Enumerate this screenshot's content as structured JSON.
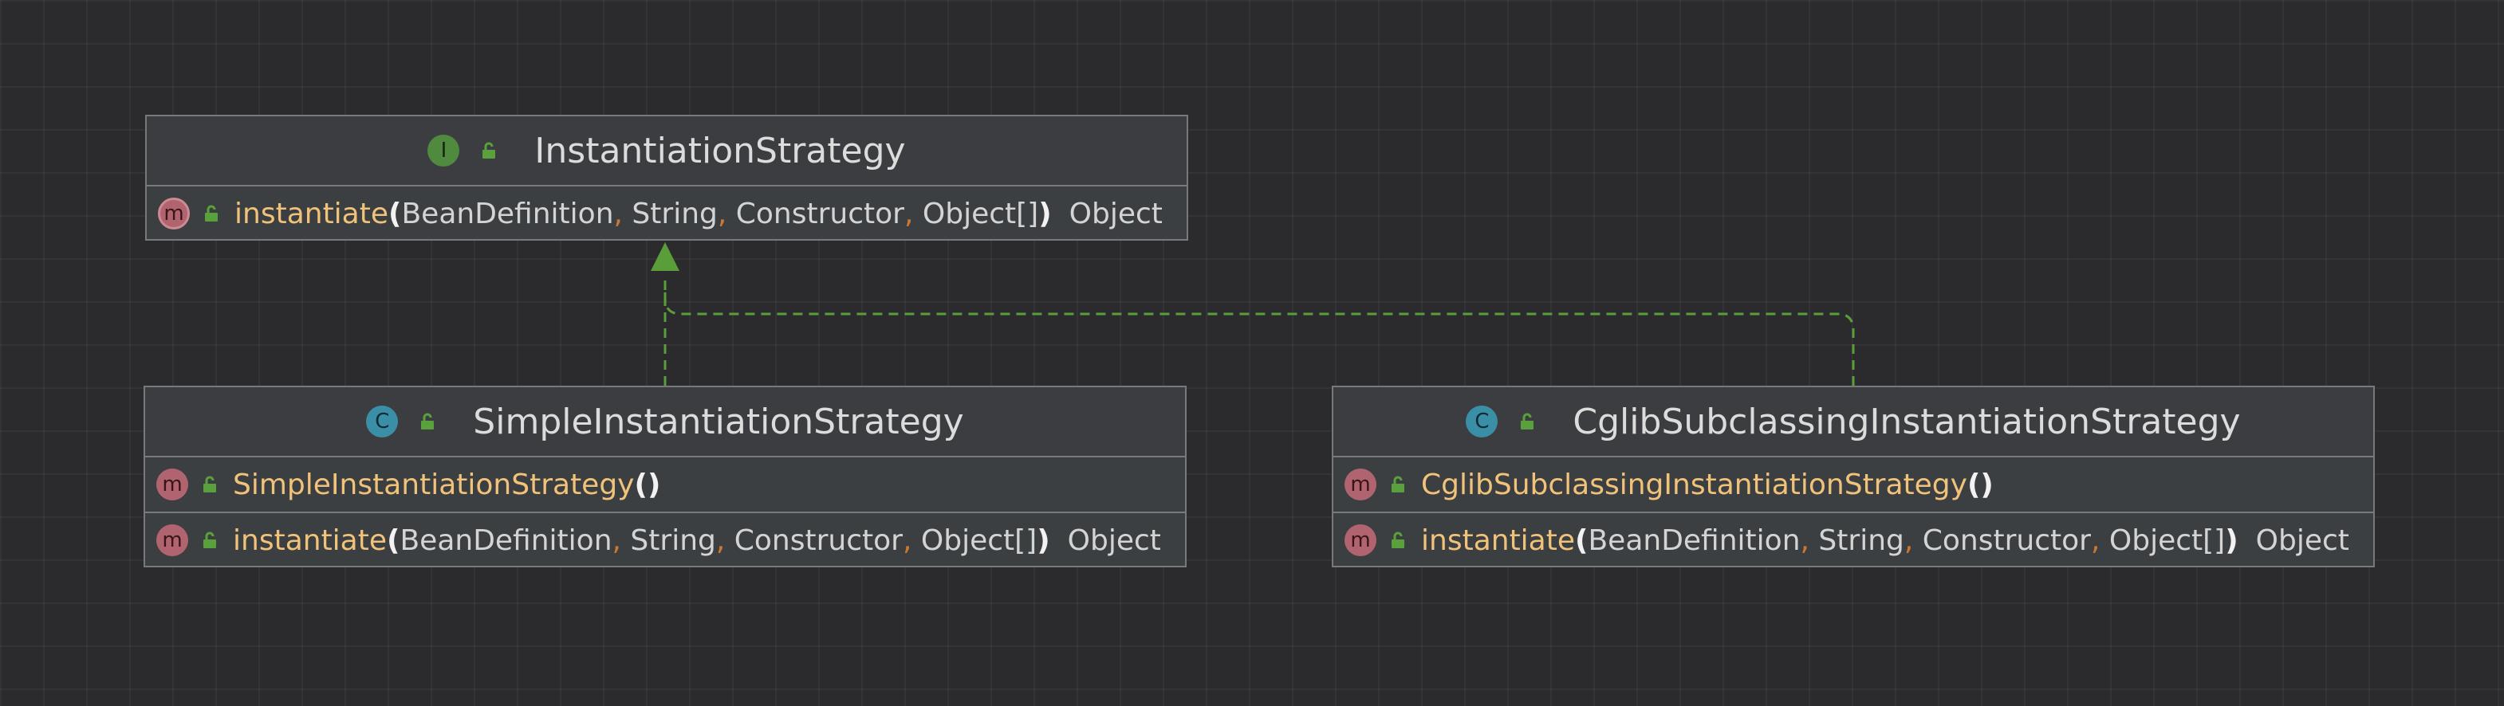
{
  "diagram": {
    "classes": [
      {
        "id": "instantiation-strategy",
        "kind_icon": "I",
        "name": "InstantiationStrategy",
        "members": [
          {
            "icon": "m",
            "name": "instantiate",
            "open": "(",
            "params": [
              "BeanDefinition",
              "String",
              "Constructor",
              "Object[]"
            ],
            "close": ")",
            "return": "Object"
          }
        ]
      },
      {
        "id": "simple-instantiation-strategy",
        "kind_icon": "C",
        "name": "SimpleInstantiationStrategy",
        "members": [
          {
            "icon": "m",
            "name": "SimpleInstantiationStrategy",
            "open": "(",
            "close": ")"
          },
          {
            "icon": "m",
            "name": "instantiate",
            "open": "(",
            "params": [
              "BeanDefinition",
              "String",
              "Constructor",
              "Object[]"
            ],
            "close": ")",
            "return": "Object"
          }
        ]
      },
      {
        "id": "cglib-subclassing-instantiation-strategy",
        "kind_icon": "C",
        "name": "CglibSubclassingInstantiationStrategy",
        "members": [
          {
            "icon": "m",
            "name": "CglibSubclassingInstantiationStrategy",
            "open": "(",
            "close": ")"
          },
          {
            "icon": "m",
            "name": "instantiate",
            "open": "(",
            "params": [
              "BeanDefinition",
              "String",
              "Constructor",
              "Object[]"
            ],
            "close": ")",
            "return": "Object"
          }
        ]
      }
    ],
    "relations": [
      {
        "from": "simple-instantiation-strategy",
        "to": "instantiation-strategy",
        "type": "implements"
      },
      {
        "from": "cglib-subclassing-instantiation-strategy",
        "to": "instantiation-strategy",
        "type": "implements"
      }
    ],
    "separator": ",",
    "colors": {
      "background": "#2b2b2d",
      "box": "#3c3f41",
      "border": "#77797c",
      "method_name": "#f0c27a",
      "comma": "#cc7832",
      "relation": "#5a9e3a",
      "interface_icon": "#4f8a3f",
      "class_icon": "#3a8fa6",
      "method_icon": "#b0646f"
    }
  }
}
